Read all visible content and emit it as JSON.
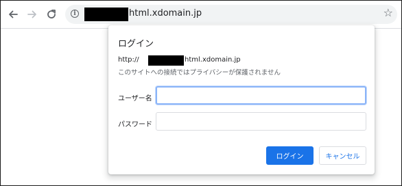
{
  "browser": {
    "back_icon": "arrow-left-icon",
    "forward_icon": "arrow-right-icon",
    "reload_icon": "reload-icon",
    "info_icon": "info-icon",
    "info_glyph": "i",
    "url_visible": "html.xdomain.jp",
    "bookmark_icon": "star-icon"
  },
  "dialog": {
    "title": "ログイン",
    "origin_prefix": "http://",
    "origin_host": "html.xdomain.jp",
    "privacy_note": "このサイトへの接続ではプライバシーが保護されません",
    "username_label": "ユーザー名",
    "username_value": "",
    "password_label": "パスワード",
    "password_value": "",
    "login_button": "ログイン",
    "cancel_button": "キャンセル"
  },
  "colors": {
    "accent": "#1a73e8",
    "focus_ring": "#8ab4f8",
    "omnibox_bg": "#f1f3f4",
    "redaction": "#000000"
  }
}
